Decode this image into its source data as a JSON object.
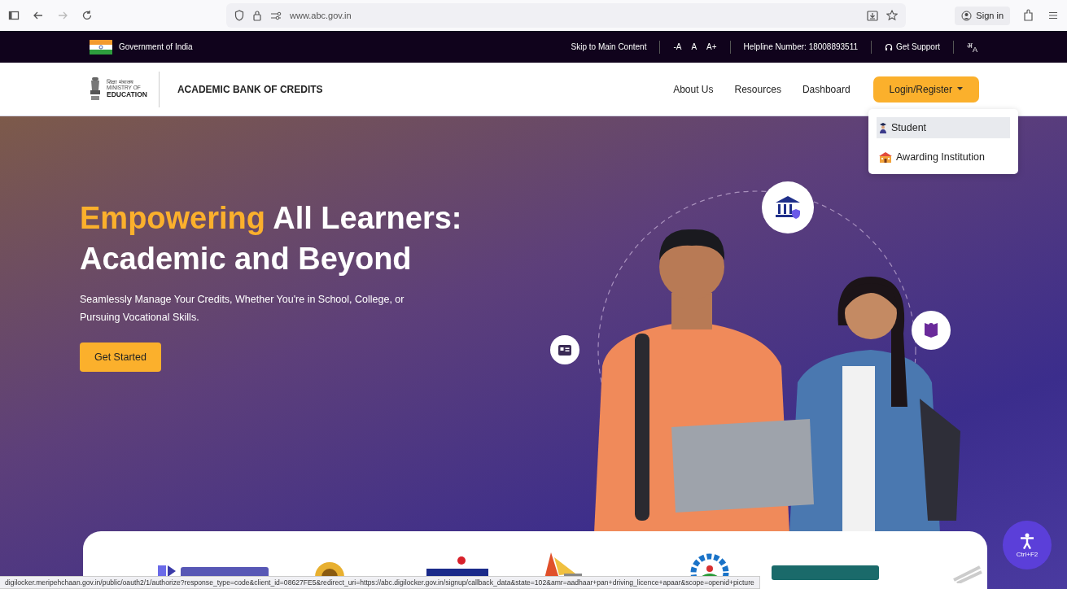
{
  "browser": {
    "url": "www.abc.gov.in",
    "forward_disabled": true,
    "sign_in": "Sign in"
  },
  "gov_bar": {
    "label": "Government of India",
    "skip_link": "Skip to Main Content",
    "font_sizes": [
      "-A",
      "A",
      "A+"
    ],
    "helpline": "Helpline Number: 18008893511",
    "support": "Get Support",
    "language": [
      "अ",
      "A"
    ]
  },
  "header": {
    "ministry": [
      "शिक्षा मंत्रालय",
      "MINISTRY OF",
      "EDUCATION"
    ],
    "title": "ACADEMIC BANK OF CREDITS",
    "nav": [
      "About Us",
      "Resources",
      "Dashboard"
    ],
    "login": {
      "label": "Login/Register",
      "expanded": true
    },
    "menu": [
      {
        "label": "Student",
        "kind": "student",
        "selected": true
      },
      {
        "label": "Awarding Institution",
        "kind": "institution",
        "selected": false
      }
    ]
  },
  "hero": {
    "title_highlight": "Empowering",
    "title_rest": "All Learners: Academic and Beyond",
    "subtitle": "Seamlessly Manage Your Credits, Whether You're in School, College, or Pursuing Vocational Skills.",
    "button": "Get Started"
  },
  "accessibility": {
    "shortcut": "Ctrl+F2"
  },
  "status_bar": "digilocker.meripehchaan.gov.in/public/oauth2/1/authorize?response_type=code&client_id=08627FE5&redirect_uri=https://abc.digilocker.gov.in/signup/callback_data&state=102&amr=aadhaar+pan+driving_licence+apaar&scope=openid+picture"
}
